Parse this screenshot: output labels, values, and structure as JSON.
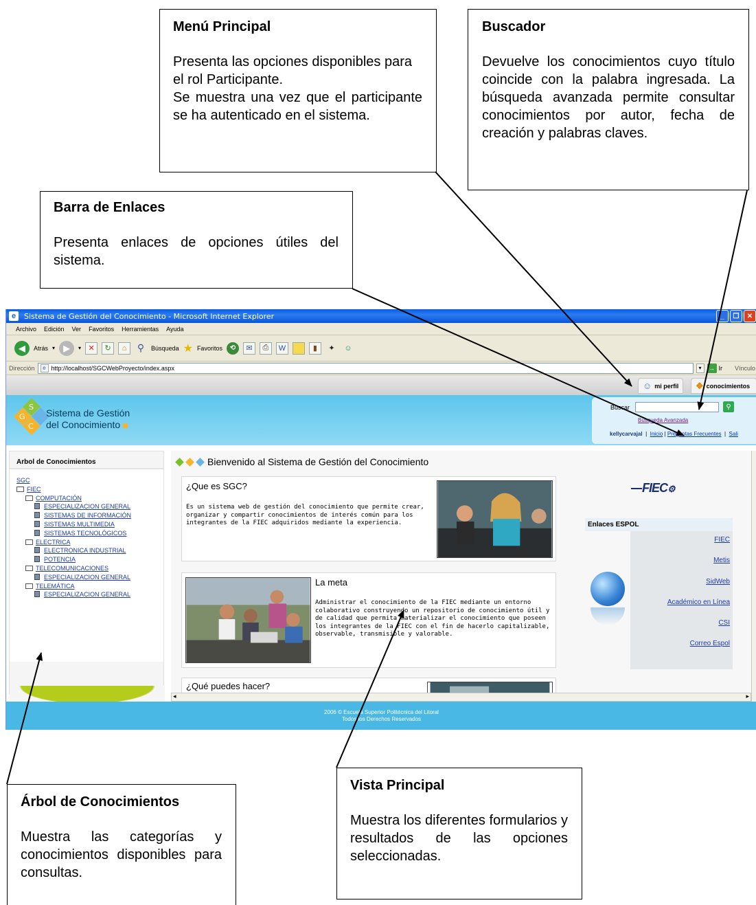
{
  "callouts": {
    "menu": {
      "title": "Menú Principal",
      "text": "Presenta las opciones disponibles para el rol Participante.",
      "text2": "Se muestra una vez que el participante se ha autenticado en el sistema."
    },
    "buscador": {
      "title": "Buscador",
      "text": "Devuelve los conocimientos cuyo título coincide con la palabra ingresada. La búsqueda avanzada permite consultar conocimientos por autor, fecha de creación y palabras claves."
    },
    "barra": {
      "title": "Barra  de Enlaces",
      "text": "Presenta enlaces de opciones útiles del sistema."
    },
    "arbol": {
      "title": "Árbol de Conocimientos",
      "text": "Muestra las categorías y conocimientos disponibles para consultas."
    },
    "vista": {
      "title": "Vista Principal",
      "text": "Muestra los diferentes formularios y resultados de las opciones seleccionadas."
    }
  },
  "browser": {
    "title": "Sistema de Gestión del Conocimiento - Microsoft Internet Explorer",
    "menu": [
      "Archivo",
      "Edición",
      "Ver",
      "Favoritos",
      "Herramientas",
      "Ayuda"
    ],
    "toolbar": {
      "back": "Atrás",
      "search": "Búsqueda",
      "favorites": "Favoritos"
    },
    "address_label": "Dirección",
    "url": "http://localhost/SGCWebProyecto/index.aspx",
    "go": "Ir",
    "links": "Vínculo"
  },
  "site": {
    "tabs": {
      "perfil": "mi perfil",
      "conocimientos": "conocimientos"
    },
    "logo_line1": "Sistema de Gestión",
    "logo_line2": "del Conocimiento",
    "search_label": "Buscar",
    "advanced_search": "Búsqueda Avanzada",
    "user": "kellycarvajal",
    "sep": "|",
    "link_inicio": "Inicio",
    "link_faq": "Preguntas Frecuentes",
    "link_exit": "Sali",
    "tree_title": "Arbol de Conocimientos",
    "tree": [
      {
        "level": 0,
        "icon": "none",
        "label": "SGC"
      },
      {
        "level": 0,
        "icon": "book",
        "label": "FIEC"
      },
      {
        "level": 1,
        "icon": "book",
        "label": "COMPUTACIÓN"
      },
      {
        "level": 2,
        "icon": "doc",
        "label": "ESPECIALIZACION GENERAL"
      },
      {
        "level": 2,
        "icon": "doc",
        "label": "SISTEMAS DE INFORMACIÓN"
      },
      {
        "level": 2,
        "icon": "doc",
        "label": "SISTEMAS MULTIMEDIA"
      },
      {
        "level": 2,
        "icon": "doc",
        "label": "SISTEMAS TECNOLÓGICOS"
      },
      {
        "level": 1,
        "icon": "book",
        "label": "ELECTRICA"
      },
      {
        "level": 2,
        "icon": "doc",
        "label": "ELECTRONICA INDUSTRIAL"
      },
      {
        "level": 2,
        "icon": "doc",
        "label": "POTENCIA"
      },
      {
        "level": 1,
        "icon": "book",
        "label": "TELECOMUNICACIONES"
      },
      {
        "level": 2,
        "icon": "doc",
        "label": "ESPECIALIZACION GENERAL"
      },
      {
        "level": 1,
        "icon": "book",
        "label": "TELEMÁTICA"
      },
      {
        "level": 2,
        "icon": "doc",
        "label": "ESPECIALIZACION GENERAL"
      }
    ],
    "welcome": "Bienvenido al Sistema de Gestión del Conocimiento",
    "card1_title": "¿Que es SGC?",
    "card1_text": "Es un sistema web de gestión del conocimiento que permite crear, organizar y compartir conocimientos de interés común para los integrantes de la FIEC adquiridos mediante la experiencia.",
    "card2_title": "La meta",
    "card2_text": "Administrar el conocimiento de la FIEC mediante un entorno colaborativo construyendo un repositorio de conocimiento útil y de calidad que permita materializar el conocimiento que poseen los integrantes de la FIEC con el fin de hacerlo capitalizable, observable, transmisible y valorable.",
    "card3_title": "¿Qué puedes hacer?",
    "fiec_logo": "FIEC",
    "enlaces_title": "Enlaces ESPOL",
    "enlaces": [
      "FIEC",
      "Metis",
      "SidWeb",
      "Académico en Línea",
      "CSI",
      "Correo Espol"
    ],
    "footer_line1": "2006 © Escuela Superior Politécnica del Litoral",
    "footer_line2": "Todos los Derechos Reservados"
  },
  "colors": {
    "banner": "#5ec6ec",
    "footer": "#49b8e4",
    "accent_green": "#b4cc1c",
    "link": "#1c3aa8"
  }
}
